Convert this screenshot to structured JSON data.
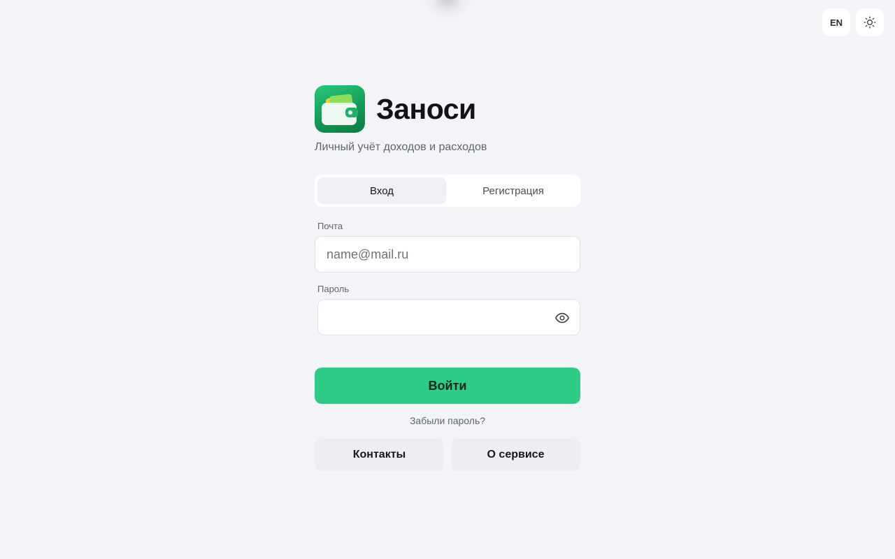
{
  "header": {
    "language_label": "EN",
    "theme_icon": "sun-icon"
  },
  "brand": {
    "app_name": "Заноси",
    "subtitle": "Личный учёт доходов и расходов",
    "logo_icon": "wallet-icon"
  },
  "tabs": [
    {
      "label": "Вход",
      "active": true
    },
    {
      "label": "Регистрация",
      "active": false
    }
  ],
  "form": {
    "email_label": "Почта",
    "email_placeholder": "name@mail.ru",
    "email_value": "",
    "password_label": "Пароль",
    "password_value": "",
    "password_toggle_icon": "eye-icon",
    "submit_label": "Войти",
    "forgot_label": "Забыли пароль?"
  },
  "footer": {
    "contacts_label": "Контакты",
    "about_label": "О сервисе"
  },
  "colors": {
    "background": "#f2f4f7",
    "accent": "#2ecc87",
    "logo_green": "#169a57"
  }
}
